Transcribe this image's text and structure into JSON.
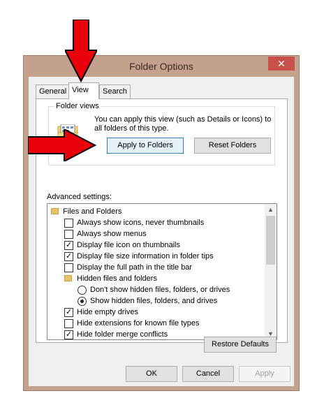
{
  "window": {
    "title": "Folder Options",
    "close_glyph": "✕"
  },
  "tabs": [
    {
      "label": "General"
    },
    {
      "label": "View"
    },
    {
      "label": "Search"
    }
  ],
  "folder_views": {
    "group_label": "Folder views",
    "description": "You can apply this view (such as Details or Icons) to all folders of this type.",
    "apply_button": "Apply to Folders",
    "reset_button": "Reset Folders"
  },
  "advanced": {
    "label": "Advanced settings:",
    "items": [
      {
        "text": "Files and Folders",
        "kind": "folder",
        "level": 0
      },
      {
        "text": "Always show icons, never thumbnails",
        "kind": "checkbox",
        "checked": false
      },
      {
        "text": "Always show menus",
        "kind": "checkbox",
        "checked": false
      },
      {
        "text": "Display file icon on thumbnails",
        "kind": "checkbox",
        "checked": true
      },
      {
        "text": "Display file size information in folder tips",
        "kind": "checkbox",
        "checked": true
      },
      {
        "text": "Display the full path in the title bar",
        "kind": "checkbox",
        "checked": false
      },
      {
        "text": "Hidden files and folders",
        "kind": "folder",
        "level": 1
      },
      {
        "text": "Don't show hidden files, folders, or drives",
        "kind": "radio",
        "checked": false
      },
      {
        "text": "Show hidden files, folders, and drives",
        "kind": "radio",
        "checked": true
      },
      {
        "text": "Hide empty drives",
        "kind": "checkbox",
        "checked": true
      },
      {
        "text": "Hide extensions for known file types",
        "kind": "checkbox",
        "checked": false
      },
      {
        "text": "Hide folder merge conflicts",
        "kind": "checkbox",
        "checked": true
      }
    ],
    "restore_button": "Restore Defaults"
  },
  "dialog_buttons": {
    "ok": "OK",
    "cancel": "Cancel",
    "apply": "Apply"
  },
  "colors": {
    "frame": "#c4a18c",
    "close_button": "#c7504b",
    "annotation_arrow": "#e8000b"
  },
  "icons": {
    "check_glyph": "✓",
    "scroll_up_glyph": "▲",
    "scroll_down_glyph": "▼"
  }
}
